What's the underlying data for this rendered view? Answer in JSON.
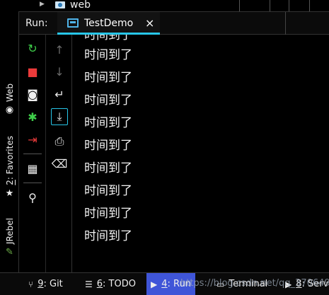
{
  "top_strip": {
    "node_label": "web"
  },
  "left_bar": {
    "tabs": [
      {
        "name": "web",
        "num": "",
        "label": "Web",
        "icon": "globe-icon",
        "glyph": "◉"
      },
      {
        "name": "favorites",
        "num": "2",
        "label": "Favorites",
        "icon": "star-icon",
        "glyph": "★"
      },
      {
        "name": "jrebel",
        "num": "",
        "label": "JRebel",
        "icon": "jrebel-icon",
        "glyph": "✎"
      }
    ]
  },
  "run_header": {
    "label": "Run:",
    "tab_title": "TestDemo",
    "close_glyph": "×"
  },
  "toolbar_1": [
    {
      "name": "rerun-icon",
      "glyph": "↻",
      "color": "#3fcf4a"
    },
    {
      "name": "stop-icon",
      "glyph": "■",
      "color": "#ec3b3b"
    },
    {
      "name": "camera-icon",
      "glyph": "◙",
      "color": "#eeeeee"
    },
    {
      "name": "debug-icon",
      "glyph": "✱",
      "color": "#3fcf4a"
    },
    {
      "name": "exit-icon",
      "glyph": "⇥",
      "color": "#ec3b3b"
    },
    {
      "name": "layout-icon",
      "glyph": "▦",
      "color": "#eeeeee"
    },
    {
      "name": "pin-icon",
      "glyph": "⚲",
      "color": "#eeeeee"
    }
  ],
  "toolbar_2": [
    {
      "name": "up-arrow-icon",
      "glyph": "↑",
      "color": "#6a6a6a"
    },
    {
      "name": "down-arrow-icon",
      "glyph": "↓",
      "color": "#6a6a6a"
    },
    {
      "name": "soft-wrap-icon",
      "glyph": "↵",
      "color": "#eeeeee"
    },
    {
      "name": "scroll-to-end-icon",
      "glyph": "⤓",
      "color": "#eeeeee"
    },
    {
      "name": "print-icon",
      "glyph": "⎙",
      "color": "#eeeeee"
    },
    {
      "name": "trash-icon",
      "glyph": "⌫",
      "color": "#eeeeee"
    }
  ],
  "console": {
    "lines": [
      "时间到了",
      "时间到了",
      "时间到了",
      "时间到了",
      "时间到了",
      "时间到了",
      "时间到了",
      "时间到了",
      "时间到了"
    ]
  },
  "bottom_bar": {
    "git": {
      "num": "9",
      "label": ": Git"
    },
    "todo": {
      "num": "6",
      "label": ": TODO"
    },
    "run": {
      "num": "4",
      "label": ": Run"
    },
    "terminal": {
      "label": "Terminal"
    },
    "services": {
      "num": "8",
      "label": ": Serv"
    },
    "watermark": "https://blog.csdn.net/qq_37064905"
  }
}
